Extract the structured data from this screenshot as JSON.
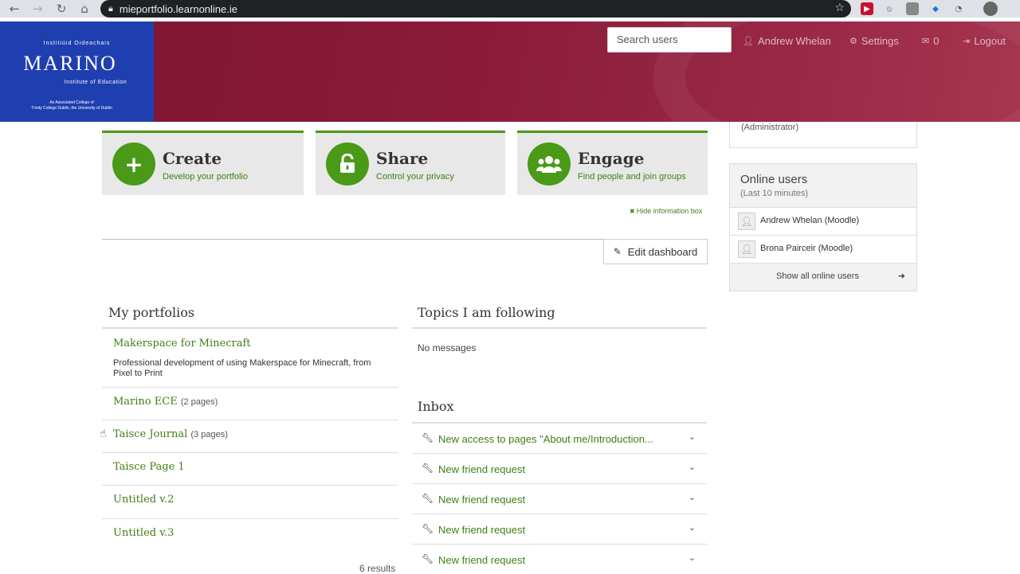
{
  "browser": {
    "url": "mieportfolio.learnonline.ie",
    "back_icon": "arrow-left-icon",
    "forward_icon": "arrow-right-icon",
    "reload_icon": "reload-icon",
    "home_icon": "home-icon"
  },
  "logo": {
    "top": "Institiúid Oideachais",
    "main": "MARINO",
    "sub": "Institute of Education",
    "foot1": "An Associated College of",
    "foot2": "Trinity College Dublin, the University of Dublin"
  },
  "header": {
    "search_placeholder": "Search users",
    "user": "Andrew Whelan",
    "settings": "Settings",
    "inbox_count": "0",
    "logout": "Logout"
  },
  "cards": [
    {
      "title": "Create",
      "sub": "Develop your portfolio",
      "icon": "plus-icon"
    },
    {
      "title": "Share",
      "sub": "Control your privacy",
      "icon": "unlock-icon"
    },
    {
      "title": "Engage",
      "sub": "Find people and join groups",
      "icon": "users-icon"
    }
  ],
  "hide_info": "Hide information box",
  "edit_dashboard": "Edit dashboard",
  "portfolios": {
    "title": "My portfolios",
    "items": [
      {
        "name": "Makerspace for Minecraft",
        "count": "",
        "desc": "Professional development of using Makerspace for Minecraft, from Pixel to Print"
      },
      {
        "name": "Marino ECE",
        "count": "(2 pages)"
      },
      {
        "name": "Taisce Journal",
        "count": "(3 pages)"
      },
      {
        "name": "Taisce Page 1",
        "count": ""
      },
      {
        "name": "Untitled v.2",
        "count": ""
      },
      {
        "name": "Untitled v.3",
        "count": ""
      }
    ],
    "results": "6 results"
  },
  "topics": {
    "title": "Topics I am following",
    "empty": "No messages"
  },
  "inbox": {
    "title": "Inbox",
    "items": [
      "New access to pages \"About me/Introduction...",
      "New friend request",
      "New friend request",
      "New friend request",
      "New friend request"
    ]
  },
  "sidebar": {
    "role": "(Administrator)",
    "online_title": "Online users",
    "online_sub": "(Last 10 minutes)",
    "users": [
      "Andrew Whelan (Moodle)",
      "Brona Pairceir (Moodle)"
    ],
    "show_all": "Show all online users"
  },
  "colors": {
    "accent_green": "#4a9a18",
    "header_maroon": "#8b1a3a",
    "logo_blue": "#1f3fb0"
  }
}
